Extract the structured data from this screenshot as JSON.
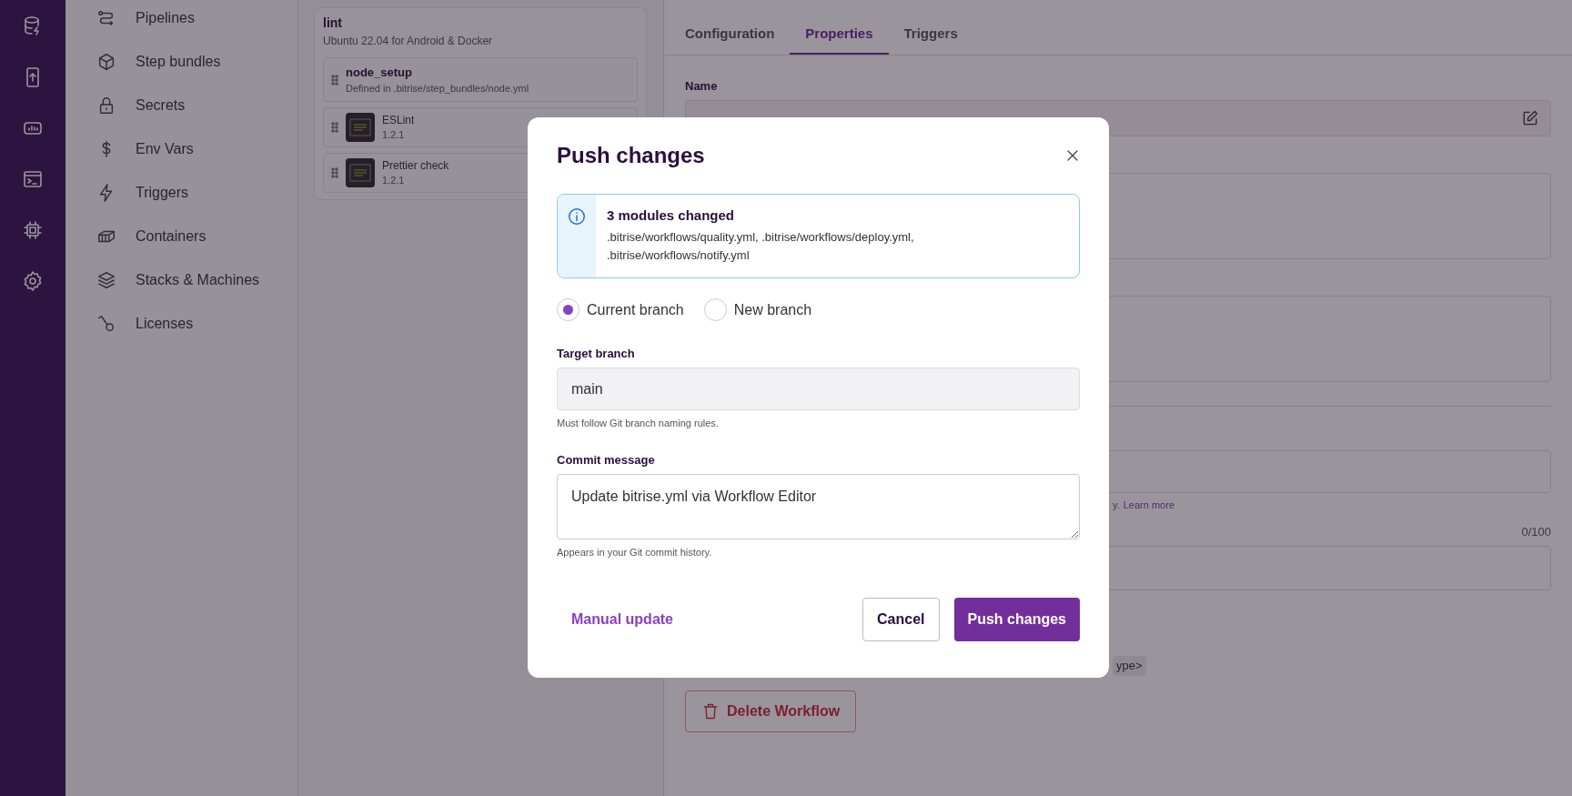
{
  "nav": {
    "items": [
      {
        "label": "Pipelines"
      },
      {
        "label": "Step bundles"
      },
      {
        "label": "Secrets"
      },
      {
        "label": "Env Vars"
      },
      {
        "label": "Triggers"
      },
      {
        "label": "Containers"
      },
      {
        "label": "Stacks & Machines"
      },
      {
        "label": "Licenses"
      }
    ]
  },
  "workflow_card": {
    "title": "lint",
    "subtitle": "Ubuntu 22.04 for Android & Docker",
    "steps": [
      {
        "kind": "bundle",
        "title": "node_setup",
        "subtitle": "Defined in .bitrise/step_bundles/node.yml"
      },
      {
        "kind": "step",
        "title": "ESLint",
        "subtitle": "1.2.1"
      },
      {
        "kind": "step",
        "title": "Prettier check",
        "subtitle": "1.2.1"
      }
    ]
  },
  "tabs": [
    {
      "label": "Configuration",
      "selected": false
    },
    {
      "label": "Properties",
      "selected": true
    },
    {
      "label": "Triggers",
      "selected": false
    }
  ],
  "properties": {
    "name_label": "Name",
    "hint_tail": "y.",
    "hint_link": "Learn more",
    "counter": "0/100",
    "chip": "ype>",
    "delete_button": "Delete Workflow"
  },
  "modal": {
    "title": "Push changes",
    "info": {
      "title": "3 modules changed",
      "body": ".bitrise/workflows/quality.yml, .bitrise/workflows/deploy.yml, .bitrise/workflows/notify.yml"
    },
    "branch_options": [
      {
        "label": "Current branch",
        "selected": true
      },
      {
        "label": "New branch",
        "selected": false
      }
    ],
    "target_branch": {
      "label": "Target branch",
      "value": "main",
      "hint": "Must follow Git branch naming rules."
    },
    "commit_message": {
      "label": "Commit message",
      "value": "Update bitrise.yml via Workflow Editor",
      "hint": "Appears in your Git commit history."
    },
    "manual_update": "Manual update",
    "cancel": "Cancel",
    "push": "Push changes"
  }
}
